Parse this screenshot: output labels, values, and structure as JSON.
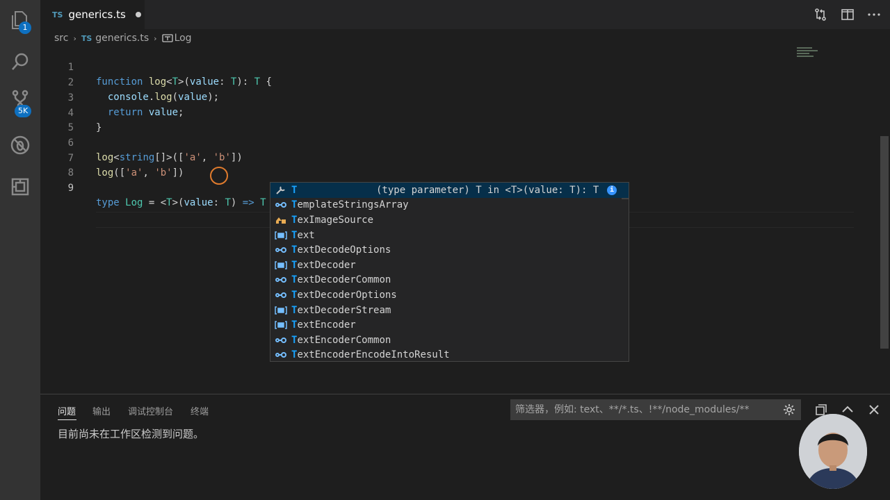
{
  "activity_bar": {
    "explorer_badge": "1",
    "source_control_badge": "5K"
  },
  "tab": {
    "lang_tag": "TS",
    "file_name": "generics.ts"
  },
  "breadcrumb": {
    "folder": "src",
    "file_tag": "TS",
    "file": "generics.ts",
    "symbol": "Log"
  },
  "editor": {
    "line_numbers": [
      "1",
      "2",
      "3",
      "4",
      "5",
      "6",
      "7",
      "8",
      "9"
    ],
    "active_line": "9"
  },
  "suggest": {
    "items": [
      {
        "match": "T",
        "rest": "",
        "kind": "type-parameter",
        "detail": "(type parameter) T in <T>(value: T): T",
        "selected": true
      },
      {
        "match": "T",
        "rest": "emplateStringsArray",
        "kind": "interface"
      },
      {
        "match": "T",
        "rest": "exImageSource",
        "kind": "type-alias"
      },
      {
        "match": "T",
        "rest": "ext",
        "kind": "variable"
      },
      {
        "match": "T",
        "rest": "extDecodeOptions",
        "kind": "interface"
      },
      {
        "match": "T",
        "rest": "extDecoder",
        "kind": "variable"
      },
      {
        "match": "T",
        "rest": "extDecoderCommon",
        "kind": "interface"
      },
      {
        "match": "T",
        "rest": "extDecoderOptions",
        "kind": "interface"
      },
      {
        "match": "T",
        "rest": "extDecoderStream",
        "kind": "variable"
      },
      {
        "match": "T",
        "rest": "extEncoder",
        "kind": "variable"
      },
      {
        "match": "T",
        "rest": "extEncoderCommon",
        "kind": "interface"
      },
      {
        "match": "T",
        "rest": "extEncoderEncodeIntoResult",
        "kind": "interface"
      }
    ],
    "info_glyph": "i"
  },
  "panel": {
    "tabs": [
      "问题",
      "输出",
      "调试控制台",
      "终端"
    ],
    "filter_placeholder": "筛选器，例如: text、**/*.ts、!**/node_modules/**",
    "message": "目前尚未在工作区检测到问题。"
  },
  "colors": {
    "activity_bg": "#333333",
    "editor_bg": "#1e1e1e",
    "badge": "#0e70c0",
    "keyword": "#569cd6",
    "function": "#dcdcaa",
    "type": "#4ec9b0",
    "variable": "#9cdcfe",
    "string": "#ce9178",
    "suggest_highlight": "#18a3ff",
    "cursor_ring": "#e07b2d"
  }
}
